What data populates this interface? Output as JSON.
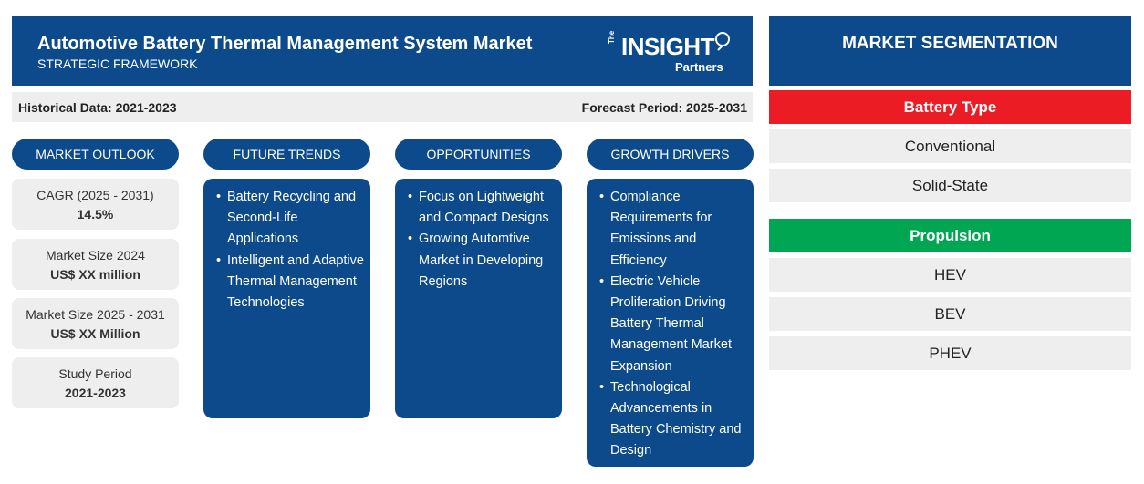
{
  "header": {
    "title": "Automotive Battery Thermal Management System Market",
    "subtitle": "STRATEGIC FRAMEWORK",
    "logo": {
      "the": "The",
      "insight": "INSIGHT",
      "partners": "Partners"
    }
  },
  "databar": {
    "historical": "Historical Data: 2021-2023",
    "forecast": "Forecast Period: 2025-2031"
  },
  "sections": {
    "outlook": "MARKET OUTLOOK",
    "trends": "FUTURE TRENDS",
    "opportunities": "OPPORTUNITIES",
    "drivers": "GROWTH DRIVERS"
  },
  "outlook": [
    {
      "label": "CAGR (2025 - 2031)",
      "value": "14.5%"
    },
    {
      "label": "Market Size 2024",
      "value": "US$ XX million"
    },
    {
      "label": "Market Size 2025 - 2031",
      "value": "US$ XX Million"
    },
    {
      "label": "Study Period",
      "value": "2021-2023"
    }
  ],
  "trends": [
    "Battery Recycling and Second-Life Applications",
    "Intelligent and Adaptive Thermal Management Technologies"
  ],
  "opportunities": [
    "Focus on Lightweight and Compact Designs",
    "Growing Automtive Market in Developing Regions"
  ],
  "drivers": [
    "Compliance Requirements for Emissions and Efficiency",
    "Electric Vehicle Proliferation Driving Battery Thermal Management Market Expansion",
    "Technological Advancements in Battery Chemistry and Design"
  ],
  "segmentation": {
    "title": "MARKET SEGMENTATION",
    "groups": [
      {
        "heading": "Battery Type",
        "color": "#ec1c24",
        "items": [
          "Conventional",
          "Solid-State"
        ]
      },
      {
        "heading": "Propulsion",
        "color": "#00a651",
        "items": [
          "HEV",
          "BEV",
          "PHEV"
        ]
      }
    ]
  },
  "colors": {
    "brand": "#0d4a8b",
    "panel": "#eeeeee"
  }
}
